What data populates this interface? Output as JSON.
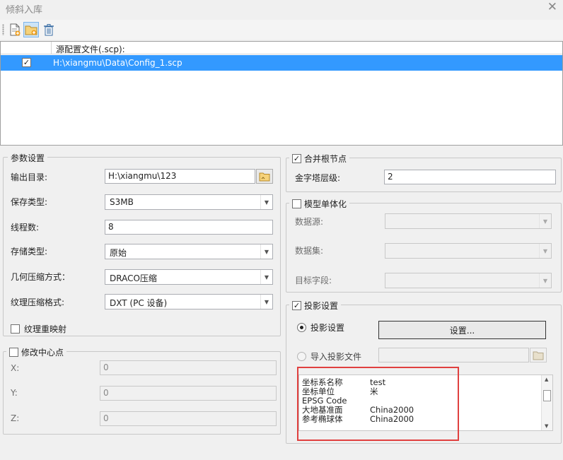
{
  "window": {
    "title": "倾斜入库",
    "close_symbol": "✕"
  },
  "toolbar": {
    "buttons": [
      {
        "name": "add-file",
        "icon": "add-file-icon"
      },
      {
        "name": "add-folder",
        "icon": "add-folder-icon"
      },
      {
        "name": "delete",
        "icon": "trash-icon"
      }
    ]
  },
  "file_list": {
    "column_header": "源配置文件(.scp):",
    "rows": [
      {
        "checked": true,
        "path": "H:\\xiangmu\\Data\\Config_1.scp"
      }
    ]
  },
  "params": {
    "legend": "参数设置",
    "output_dir": {
      "label": "输出目录:",
      "value": "H:\\xiangmu\\123"
    },
    "save_type": {
      "label": "保存类型:",
      "value": "S3MB"
    },
    "threads": {
      "label": "线程数:",
      "value": "8"
    },
    "storage_type": {
      "label": "存储类型:",
      "value": "原始"
    },
    "geometry_compression": {
      "label": "几何压缩方式：",
      "value": "DRACO压缩"
    },
    "texture_compression": {
      "label": "纹理压缩格式:",
      "value": "DXT (PC 设备)"
    },
    "texture_remap": {
      "label": "纹理重映射",
      "checked": false
    }
  },
  "center": {
    "legend": "修改中心点",
    "checked": false,
    "x": {
      "label": "X:",
      "value": "0"
    },
    "y": {
      "label": "Y:",
      "value": "0"
    },
    "z": {
      "label": "Z:",
      "value": "0"
    }
  },
  "merge_root": {
    "legend": "合并根节点",
    "checked": true,
    "pyramid_level": {
      "label": "金字塔层级:",
      "value": "2"
    }
  },
  "monomer": {
    "legend": "模型单体化",
    "checked": false,
    "datasource": {
      "label": "数据源:",
      "value": ""
    },
    "dataset": {
      "label": "数据集:",
      "value": ""
    },
    "target_field": {
      "label": "目标字段:",
      "value": ""
    }
  },
  "projection": {
    "legend": "投影设置",
    "checked": true,
    "radio_setting": {
      "label": "投影设置",
      "selected": true
    },
    "settings_button": "设置...",
    "radio_import": {
      "label": "导入投影文件",
      "selected": false
    },
    "import_path": "",
    "info": [
      {
        "key": "坐标系名称",
        "value": "test"
      },
      {
        "key": "坐标单位",
        "value": "米"
      },
      {
        "key": "EPSG Code",
        "value": ""
      },
      {
        "key": "大地基准面",
        "value": "China2000"
      },
      {
        "key": "参考椭球体",
        "value": "China2000"
      }
    ]
  },
  "colors": {
    "selection": "#3399ff",
    "highlight_box": "#e0403f"
  }
}
